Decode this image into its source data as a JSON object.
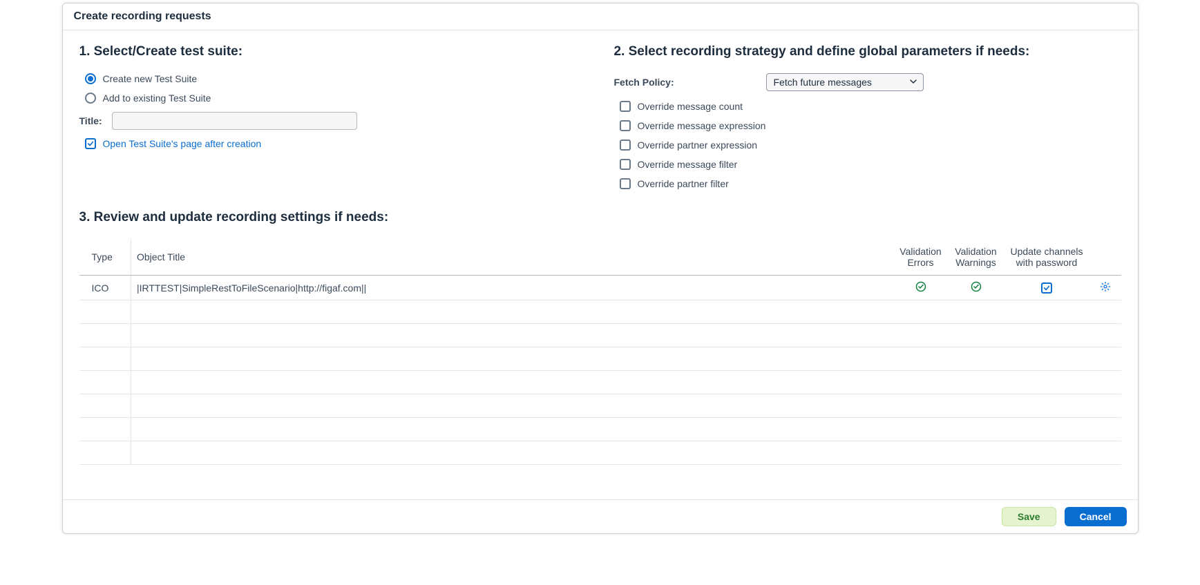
{
  "dialog": {
    "title": "Create recording requests"
  },
  "section1": {
    "heading": "1. Select/Create test suite:",
    "radio_create": "Create new Test Suite",
    "radio_add": "Add to existing Test Suite",
    "title_label": "Title:",
    "title_value": "",
    "open_after": "Open Test Suite's page after creation"
  },
  "section2": {
    "heading": "2. Select recording strategy and define global parameters if needs:",
    "fetch_label": "Fetch Policy:",
    "fetch_value": "Fetch future messages",
    "overrides": {
      "msg_count": "Override message count",
      "msg_expr": "Override message expression",
      "partner_expr": "Override partner expression",
      "msg_filter": "Override message filter",
      "partner_filter": "Override partner filter"
    }
  },
  "section3": {
    "heading": "3. Review and update recording settings if needs:",
    "columns": {
      "type": "Type",
      "object_title": "Object Title",
      "val_errors": "Validation Errors",
      "val_warnings": "Validation Warnings",
      "update_channels": "Update channels with password"
    },
    "rows": [
      {
        "type": "ICO",
        "title": "|IRTTEST|SimpleRestToFileScenario|http://figaf.com||",
        "val_errors": "ok",
        "val_warnings": "ok",
        "update_checked": true
      }
    ]
  },
  "footer": {
    "save": "Save",
    "cancel": "Cancel"
  }
}
